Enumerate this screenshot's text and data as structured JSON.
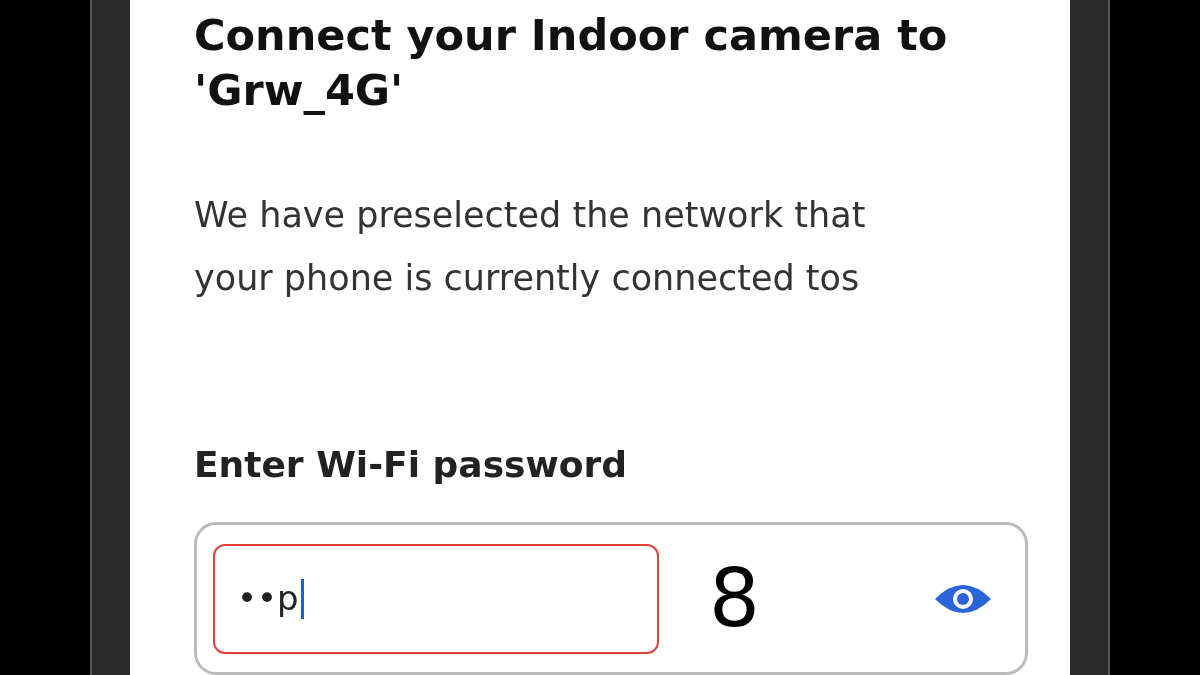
{
  "title": "Connect your Indoor camera to 'Grw_4G'",
  "description": "We have preselected the network that your phone is currently connected tos",
  "password_label": "Enter Wi-Fi password",
  "password_field": {
    "value": "••p",
    "focused": true
  },
  "annotation": "8"
}
